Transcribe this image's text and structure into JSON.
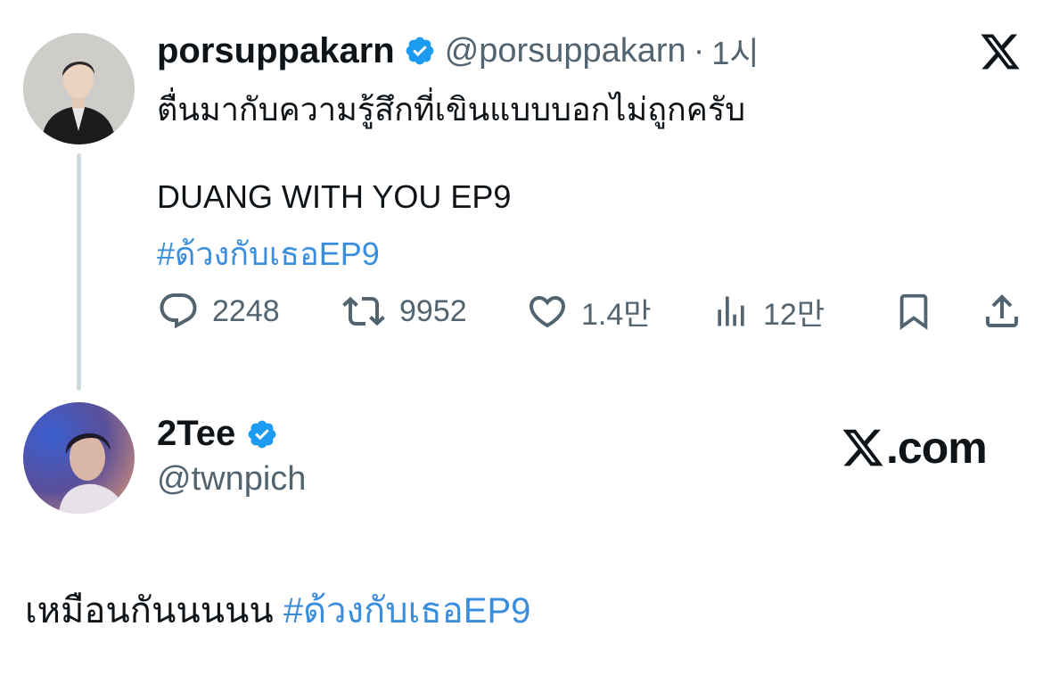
{
  "quoted_post": {
    "name": "porsuppakarn",
    "handle": "@porsuppakarn",
    "separator": "·",
    "time": "1시",
    "avatar": "profile-photo-man-in-black-suit",
    "text_line1": "ตื่นมากับความรู้สึกที่เขินแบบบอกไม่ถูกครับ",
    "text_line2": "DUANG WITH YOU EP9",
    "hashtag": "#ด้วงกับเธอEP9",
    "stats": {
      "replies": "2248",
      "reposts": "9952",
      "likes": "1.4만",
      "views": "12만"
    }
  },
  "author": {
    "name": "2Tee",
    "handle": "@twnpich",
    "avatar": "profile-photo-young-man-blue-light"
  },
  "reply": {
    "text": "เหมือนกันนนนน ",
    "hashtag": "#ด้วงกับเธอEP9"
  },
  "branding": {
    "site": ".com",
    "logo": "x-logo"
  },
  "colors": {
    "link": "#3b8ede",
    "verified": "#1d9bf0",
    "secondary_text": "#536471",
    "thread_line": "#cfd9de"
  }
}
